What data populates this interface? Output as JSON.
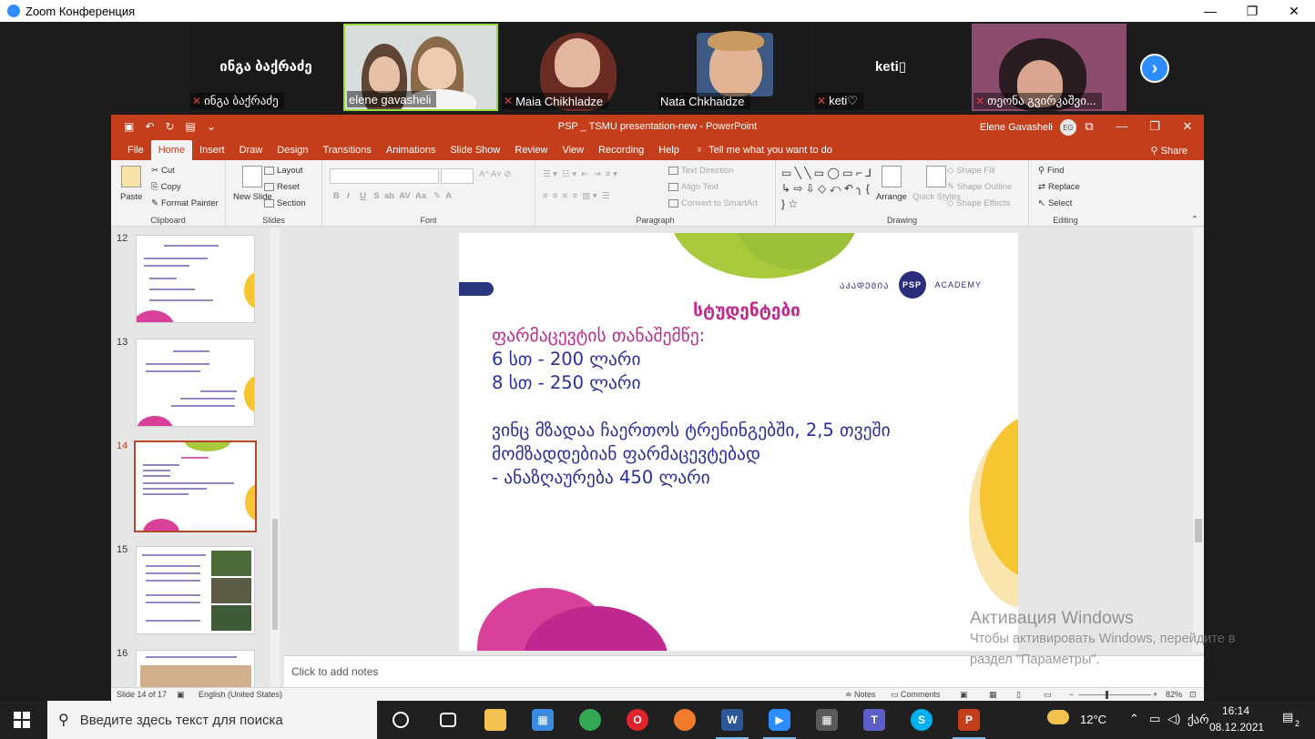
{
  "zoom": {
    "window_title": "Zoom Конференция",
    "window_controls": [
      "—",
      "❐",
      "✕"
    ],
    "participants": [
      {
        "name": "ინგა ბაქრაძე",
        "display_name": "ინგა ბაქრაძე",
        "video": false,
        "muted": true
      },
      {
        "name": "elene gavasheli",
        "video": true,
        "muted": false,
        "active_speaker": true
      },
      {
        "name": "Maia Chikhladze",
        "video": true,
        "muted": true
      },
      {
        "name": "Nata Chkhaidze",
        "video": true,
        "muted": false
      },
      {
        "name": "keti♡",
        "display_name": "keti▯",
        "video": false,
        "muted": true
      },
      {
        "name": "თეონა გვირკაშვი...",
        "video": true,
        "muted": true
      }
    ],
    "next_icon": "chevron-right-icon"
  },
  "powerpoint": {
    "title": "PSP _ TSMU presentation-new  -  PowerPoint",
    "user": "Elene Gavasheli",
    "user_initials": "EG",
    "tabs": [
      "File",
      "Home",
      "Insert",
      "Draw",
      "Design",
      "Transitions",
      "Animations",
      "Slide Show",
      "Review",
      "View",
      "Recording",
      "Help"
    ],
    "selected_tab": "Home",
    "tell_me": "Tell me what you want to do",
    "share": "Share",
    "ribbon": {
      "clipboard": {
        "label": "Clipboard",
        "paste": "Paste",
        "cut": "Cut",
        "copy": "Copy",
        "format_painter": "Format Painter"
      },
      "slides": {
        "label": "Slides",
        "new_slide": "New Slide",
        "layout": "Layout",
        "reset": "Reset",
        "section": "Section"
      },
      "font": {
        "label": "Font"
      },
      "paragraph": {
        "label": "Paragraph",
        "text_direction": "Text Direction",
        "align_text": "Align Text",
        "convert_smartart": "Convert to SmartArt"
      },
      "drawing": {
        "label": "Drawing",
        "arrange": "Arrange",
        "quick_styles": "Quick Styles",
        "shape_fill": "Shape Fill",
        "shape_outline": "Shape Outline",
        "shape_effects": "Shape Effects"
      },
      "editing": {
        "label": "Editing",
        "find": "Find",
        "replace": "Replace",
        "select": "Select"
      }
    },
    "thumbnails": [
      {
        "num": "12",
        "selected": false
      },
      {
        "num": "13",
        "selected": false
      },
      {
        "num": "14",
        "selected": true
      },
      {
        "num": "15",
        "selected": false
      },
      {
        "num": "16",
        "selected": false
      }
    ],
    "slide": {
      "logo_left": "ᲐᲙᲐᲓᲔᲛᲘᲐ",
      "logo_badge": "PSP",
      "logo_right": "ACADEMY",
      "heading": "სტუდენტები",
      "line1": "ფარმაცევტის თანაშემწე:",
      "line2": "6 სთ - 200 ლარი",
      "line3": "8 სთ - 250 ლარი",
      "line4": "ვინც მზადაა ჩაერთოს ტრენინგებში,  2,5 თვეში",
      "line5": "მომზადდებიან ფარმაცევტებად",
      "line6": "- ანაზღაურება  450 ლარი"
    },
    "notes_placeholder": "Click to add notes",
    "status": {
      "slide_count": "Slide 14 of 17",
      "language": "English (United States)",
      "notes": "Notes",
      "comments": "Comments",
      "zoom": "82%"
    }
  },
  "watermark": {
    "title": "Активация Windows",
    "line1": "Чтобы активировать Windows, перейдите в",
    "line2": "раздел \"Параметры\"."
  },
  "taskbar": {
    "search_placeholder": "Введите здесь текст для поиска",
    "weather": "12°C",
    "language": "ქარ",
    "time": "16:14",
    "date": "08.12.2021",
    "notification_count": "2"
  }
}
